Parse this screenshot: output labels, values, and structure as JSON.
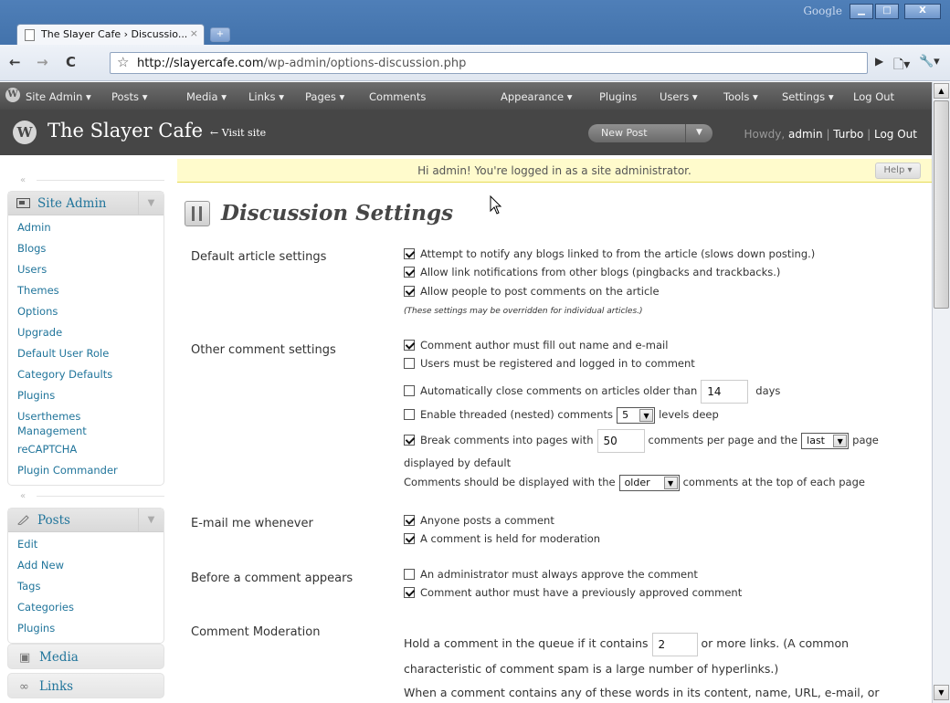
{
  "browser": {
    "brand": "Google",
    "tab_title": "The Slayer Cafe › Discussio...",
    "tab_close": "×",
    "new_tab": "+",
    "url_domain": "http://slayercafe.com",
    "url_path": "/wp-admin/options-discussion.php",
    "buttons": {
      "back": "←",
      "forward": "→",
      "reload": "C",
      "star": "☆",
      "play": "▶",
      "page": "🗋▾",
      "wrench": "🔧▾"
    },
    "window_buttons": {
      "minimize": "▁",
      "maximize": "□",
      "close": "X"
    }
  },
  "adminbar": {
    "items": [
      {
        "label": "Site Admin ▾"
      },
      {
        "label": "Posts ▾"
      },
      {
        "label": "Media ▾"
      },
      {
        "label": "Links ▾"
      },
      {
        "label": "Pages ▾"
      },
      {
        "label": "Comments"
      },
      {
        "label": "Appearance ▾"
      },
      {
        "label": "Plugins"
      },
      {
        "label": "Users ▾"
      },
      {
        "label": "Tools ▾"
      },
      {
        "label": "Settings ▾"
      },
      {
        "label": "Log Out"
      }
    ]
  },
  "header": {
    "site_title": "The Slayer Cafe",
    "visit_site": "← Visit site",
    "new_post": "New Post",
    "howdy_prefix": "Howdy, ",
    "user": "admin",
    "sep1": " | ",
    "turbo": "Turbo",
    "sep2": " | ",
    "logout": "Log Out"
  },
  "sidebar": {
    "site_admin_label": "Site Admin",
    "site_admin_items": [
      "Admin",
      "Blogs",
      "Users",
      "Themes",
      "Options",
      "Upgrade",
      "Default User Role",
      "Category Defaults",
      "Plugins",
      "Userthemes Management",
      "reCAPTCHA",
      "Plugin Commander"
    ],
    "posts_label": "Posts",
    "posts_items": [
      "Edit",
      "Add New",
      "Tags",
      "Categories",
      "Plugins"
    ],
    "media_label": "Media",
    "links_label": "Links"
  },
  "notice": {
    "text": "Hi admin! You're logged in as a site administrator.",
    "help": "Help ▾"
  },
  "page_title": "Discussion Settings",
  "sections": {
    "default_article": {
      "label": "Default article settings",
      "opt1": "Attempt to notify any blogs linked to from the article (slows down posting.)",
      "opt2": "Allow link notifications from other blogs (pingbacks and trackbacks.)",
      "opt3": "Allow people to post comments on the article",
      "note": "(These settings may be overridden for individual articles.)"
    },
    "other_comment": {
      "label": "Other comment settings",
      "opt1": "Comment author must fill out name and e-mail",
      "opt2": "Users must be registered and logged in to comment",
      "opt3_pre": "Automatically close comments on articles older than",
      "opt3_value": "14",
      "opt3_post": "days",
      "opt4_pre": "Enable threaded (nested) comments",
      "opt4_value": "5",
      "opt4_post": "levels deep",
      "opt5_pre": "Break comments into pages with",
      "opt5_value": "50",
      "opt5_mid": "comments per page and the",
      "opt5_select": "last",
      "opt5_post": "page",
      "opt5_line2": "displayed by default",
      "opt6_pre": "Comments should be displayed with the",
      "opt6_select": "older",
      "opt6_post": "comments at the top of each page"
    },
    "email_me": {
      "label": "E-mail me whenever",
      "opt1": "Anyone posts a comment",
      "opt2": "A comment is held for moderation"
    },
    "before_appears": {
      "label": "Before a comment appears",
      "opt1": "An administrator must always approve the comment",
      "opt2": "Comment author must have a previously approved comment"
    },
    "moderation": {
      "label": "Comment Moderation",
      "line1_pre": "Hold a comment in the queue if it contains",
      "line1_value": "2",
      "line1_post": "or more links. (A common",
      "line2": "characteristic of comment spam is a large number of hyperlinks.)",
      "line3": "When a comment contains any of these words in its content, name, URL, e-mail, or"
    }
  }
}
